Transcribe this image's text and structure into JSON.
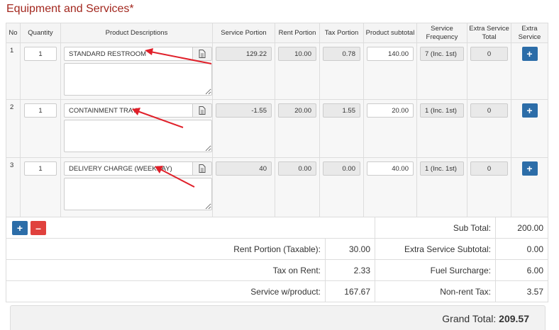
{
  "section_title": "Equipment and Services*",
  "columns": [
    "No",
    "Quantity",
    "Product Descriptions",
    "Service Portion",
    "Rent Portion",
    "Tax Portion",
    "Product subtotal",
    "Service Frequency",
    "Extra Service Total",
    "Extra Service"
  ],
  "rows": [
    {
      "no": "1",
      "quantity": "1",
      "description": "STANDARD RESTROOM",
      "service_portion": "129.22",
      "rent_portion": "10.00",
      "tax_portion": "0.78",
      "product_subtotal": "140.00",
      "service_frequency": "7 (Inc. 1st)",
      "extra_service_total": "0"
    },
    {
      "no": "2",
      "quantity": "1",
      "description": "CONTAINMENT TRAY",
      "service_portion": "-1.55",
      "rent_portion": "20.00",
      "tax_portion": "1.55",
      "product_subtotal": "20.00",
      "service_frequency": "1 (Inc. 1st)",
      "extra_service_total": "0"
    },
    {
      "no": "3",
      "quantity": "1",
      "description": "DELIVERY CHARGE (WEEKDAY)",
      "service_portion": "40",
      "rent_portion": "0.00",
      "tax_portion": "0.00",
      "product_subtotal": "40.00",
      "service_frequency": "1 (Inc. 1st)",
      "extra_service_total": "0"
    }
  ],
  "icons": {
    "add": "plus-icon",
    "remove": "minus-icon",
    "notes": "document-icon"
  },
  "colors": {
    "title": "#a3281f",
    "add_button": "#2c6da8",
    "remove_button": "#e0413d",
    "annotation_arrow": "#e0202a"
  },
  "summary": {
    "sub_total_label": "Sub Total:",
    "sub_total": "200.00",
    "rent_portion_label": "Rent Portion (Taxable):",
    "rent_portion": "30.00",
    "extra_service_subtotal_label": "Extra Service Subtotal:",
    "extra_service_subtotal": "0.00",
    "tax_on_rent_label": "Tax on Rent:",
    "tax_on_rent": "2.33",
    "fuel_surcharge_label": "Fuel Surcharge:",
    "fuel_surcharge": "6.00",
    "service_with_product_label": "Service w/product:",
    "service_with_product": "167.67",
    "non_rent_tax_label": "Non-rent Tax:",
    "non_rent_tax": "3.57",
    "grand_total_label": "Grand Total:",
    "grand_total": "209.57"
  }
}
